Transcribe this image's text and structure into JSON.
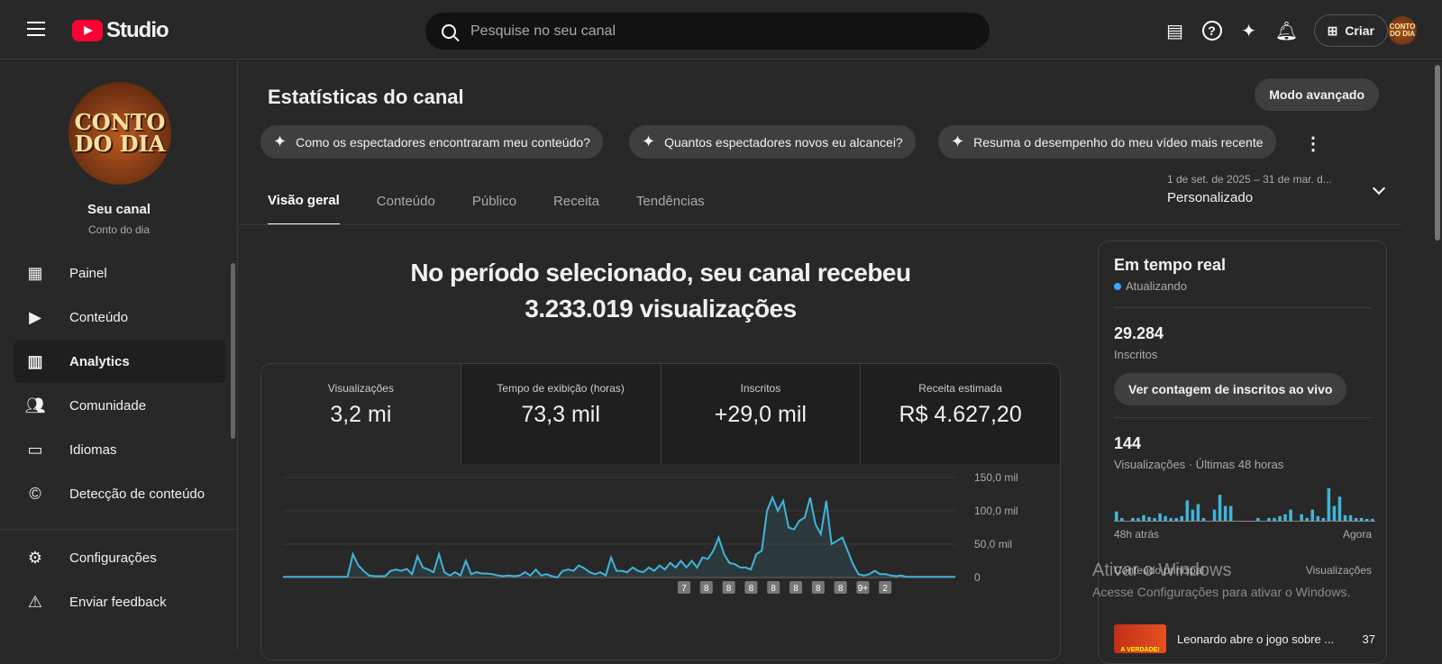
{
  "header": {
    "app": "Studio",
    "search_placeholder": "Pesquise no seu canal",
    "create_label": "Criar",
    "avatar_text": "CONTO DO DIA"
  },
  "sidebar": {
    "avatar_text": "CONTO DO DIA",
    "channel_label": "Seu canal",
    "channel_name": "Conto do dia",
    "items": [
      {
        "label": "Painel",
        "icon": "dashboard-icon"
      },
      {
        "label": "Conteúdo",
        "icon": "content-icon"
      },
      {
        "label": "Analytics",
        "icon": "analytics-icon"
      },
      {
        "label": "Comunidade",
        "icon": "community-icon"
      },
      {
        "label": "Idiomas",
        "icon": "subtitles-icon"
      },
      {
        "label": "Detecção de conteúdo",
        "icon": "copyright-icon"
      }
    ],
    "bottom": [
      {
        "label": "Configurações",
        "icon": "gear-icon"
      },
      {
        "label": "Enviar feedback",
        "icon": "feedback-icon"
      }
    ]
  },
  "main": {
    "title": "Estatísticas do canal",
    "advanced_label": "Modo avançado",
    "chips": [
      "Como os espectadores encontraram meu conteúdo?",
      "Quantos espectadores novos eu alcancei?",
      "Resuma o desempenho do meu vídeo mais recente"
    ],
    "tabs": [
      "Visão geral",
      "Conteúdo",
      "Público",
      "Receita",
      "Tendências"
    ],
    "range": {
      "dates": "1 de set. de 2025 – 31 de mar. d...",
      "preset": "Personalizado"
    },
    "headline1": "No período selecionado, seu canal recebeu",
    "headline2": "3.233.019 visualizações",
    "metrics": [
      {
        "label": "Visualizações",
        "value": "3,2 mi"
      },
      {
        "label": "Tempo de exibição (horas)",
        "value": "73,3 mil"
      },
      {
        "label": "Inscritos",
        "value": "+29,0 mil"
      },
      {
        "label": "Receita estimada",
        "value": "R$ 4.627,20"
      }
    ]
  },
  "chart_data": {
    "type": "area",
    "title": "Visualizações",
    "ylim": [
      0,
      150000
    ],
    "yticks": [
      "150,0 mil",
      "100,0 mil",
      "50,0 mil",
      "0"
    ],
    "ytick_values": [
      150000,
      100000,
      50000,
      0
    ],
    "values": [
      1,
      1,
      1,
      1,
      1,
      1,
      1,
      1,
      1,
      1,
      1,
      1,
      1,
      35,
      18,
      10,
      3,
      2,
      2,
      2,
      10,
      12,
      10,
      13,
      5,
      32,
      15,
      12,
      8,
      35,
      8,
      3,
      8,
      3,
      25,
      5,
      8,
      6,
      6,
      5,
      3,
      2,
      3,
      2,
      3,
      8,
      3,
      12,
      3,
      5,
      2,
      0,
      10,
      12,
      10,
      18,
      14,
      8,
      5,
      8,
      3,
      30,
      10,
      10,
      8,
      15,
      10,
      8,
      15,
      10,
      18,
      12,
      22,
      15,
      25,
      15,
      25,
      15,
      30,
      28,
      40,
      60,
      35,
      22,
      20,
      15,
      15,
      12,
      35,
      40,
      100,
      120,
      100,
      115,
      75,
      72,
      85,
      90,
      120,
      80,
      65,
      115,
      50,
      55,
      60,
      40,
      20,
      5,
      3,
      5,
      10,
      5,
      5,
      3,
      2,
      3,
      1,
      1,
      1,
      1,
      1,
      1,
      1,
      1,
      1,
      1
    ],
    "value_unit": "mil",
    "markers": [
      "7",
      "8",
      "8",
      "8",
      "8",
      "8",
      "8",
      "8",
      "9+",
      "2"
    ]
  },
  "realtime": {
    "title": "Em tempo real",
    "status": "Atualizando",
    "subs": "29.284",
    "subs_label": "Inscritos",
    "live_button": "Ver contagem de inscritos ao vivo",
    "views": "144",
    "views_label": "Visualizações · Últimas 48 horas",
    "start_label": "48h atrás",
    "end_label": "Agora",
    "bars": [
      10,
      3,
      0,
      3,
      3,
      6,
      4,
      3,
      8,
      5,
      3,
      3,
      5,
      22,
      12,
      18,
      3,
      0,
      12,
      28,
      16,
      16,
      0,
      0,
      0,
      0,
      3,
      0,
      3,
      3,
      5,
      7,
      12,
      0,
      7,
      3,
      12,
      5,
      3,
      35,
      16,
      26,
      6,
      6,
      3,
      3,
      2,
      2
    ],
    "col1": "Conteúdo principal",
    "col2": "Visualizações",
    "top_title": "Leonardo abre o jogo sobre ...",
    "top_views": "37",
    "thumb_text": "A VERDADE!"
  },
  "watermark": {
    "line1": "Ativar o Windows",
    "line2": "Acesse Configurações para ativar o Windows."
  },
  "colors": {
    "accent": "#3ea6ff",
    "line": "#41b4d8",
    "brand": "#ff0033"
  }
}
